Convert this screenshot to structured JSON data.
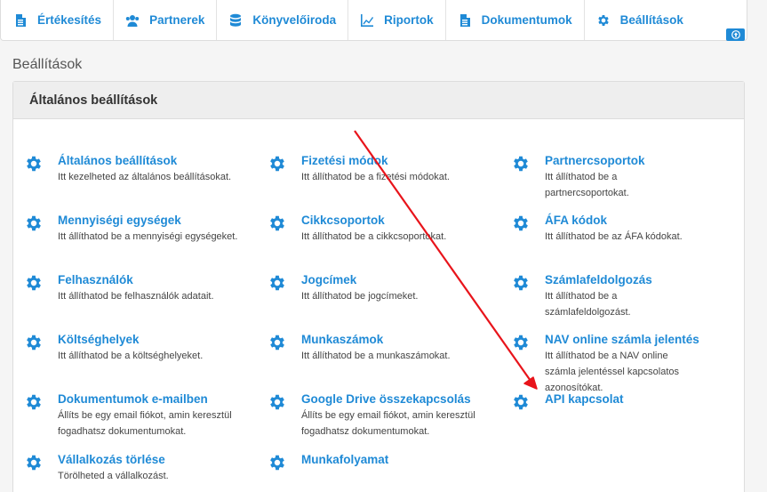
{
  "nav": {
    "items": [
      {
        "label": "Értékesítés",
        "icon": "document-icon"
      },
      {
        "label": "Partnerek",
        "icon": "users-icon"
      },
      {
        "label": "Könyvelőiroda",
        "icon": "database-icon"
      },
      {
        "label": "Riportok",
        "icon": "line-chart-icon"
      },
      {
        "label": "Dokumentumok",
        "icon": "document-icon"
      },
      {
        "label": "Beállítások",
        "icon": "gear-icon"
      }
    ]
  },
  "page": {
    "title": "Beállítások"
  },
  "panel": {
    "header": "Általános beállítások",
    "items": [
      {
        "title": "Általános beállítások",
        "desc": "Itt kezelheted az általános beállításokat."
      },
      {
        "title": "Fizetési módok",
        "desc": "Itt állíthatod be a fizetési módokat."
      },
      {
        "title": "Partnercsoportok",
        "desc": "Itt állíthatod be a partnercsoportokat."
      },
      {
        "title": "Mennyiségi egységek",
        "desc": "Itt állíthatod be a mennyiségi egységeket."
      },
      {
        "title": "Cikkcsoportok",
        "desc": "Itt állíthatod be a cikkcsoportokat."
      },
      {
        "title": "ÁFA kódok",
        "desc": "Itt állíthatod be az ÁFA kódokat."
      },
      {
        "title": "Felhasználók",
        "desc": "Itt állíthatod be felhasználók adatait."
      },
      {
        "title": "Jogcímek",
        "desc": "Itt állíthatod be jogcímeket."
      },
      {
        "title": "Számlafeldolgozás",
        "desc": "Itt állíthatod be a számlafeldolgozást."
      },
      {
        "title": "Költséghelyek",
        "desc": "Itt állíthatod be a költséghelyeket."
      },
      {
        "title": "Munkaszámok",
        "desc": "Itt állíthatod be a munkaszámokat."
      },
      {
        "title": "NAV online számla jelentés",
        "desc": "Itt állíthatod be a NAV online számla jelentéssel kapcsolatos azonosítókat."
      },
      {
        "title": "Dokumentumok e-mailben",
        "desc": "Állíts be egy email fiókot, amin keresztül fogadhatsz dokumentumokat."
      },
      {
        "title": "Google Drive összekapcsolás",
        "desc": "Állíts be egy email fiókot, amin keresztül fogadhatsz dokumentumokat."
      },
      {
        "title": "API kapcsolat",
        "desc": ""
      },
      {
        "title": "Vállalkozás törlése",
        "desc": "Törölheted a vállalkozást."
      },
      {
        "title": "Munkafolyamat",
        "desc": ""
      }
    ]
  },
  "colors": {
    "accent": "#1f8ad6",
    "annotation_arrow": "#e8141b"
  }
}
